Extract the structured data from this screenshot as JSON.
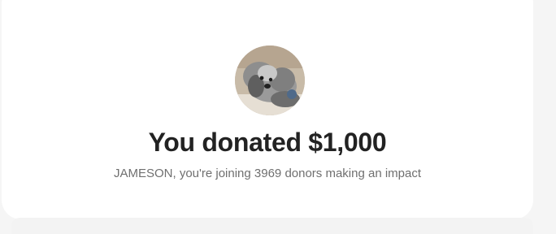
{
  "donation": {
    "title": "You donated $1,000",
    "message": "JAMESON, you're joining 3969 donors making an impact"
  },
  "avatar": {
    "icon": "dog-avatar-photo"
  }
}
